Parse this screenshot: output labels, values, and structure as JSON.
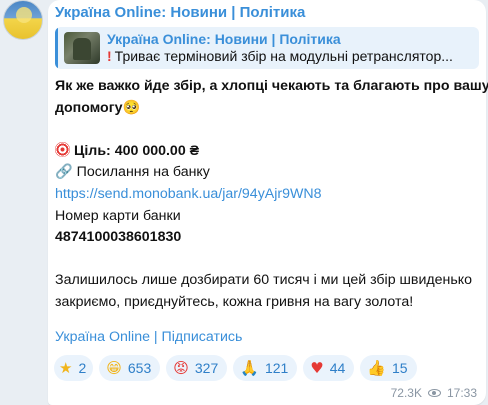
{
  "channel": {
    "title": "Україна Online: Новини | Політика"
  },
  "reply": {
    "title": "Україна Online: Новини | Політика",
    "icon": "exclamation-icon",
    "snippet": "Триває терміновий збір на модульні ретранслятор..."
  },
  "message": {
    "line1": "Як же важко йде збір, а хлопці чекають та благають про вашу",
    "line2": "допомогу",
    "goal_label": "Ціль: 400 000.00 ₴",
    "bank_link_label": "Посилання на банку",
    "bank_url": "https://send.monobank.ua/jar/94yAjr9WN8",
    "card_label": "Номер карти банки",
    "card_number": "4874100038601830",
    "remaining_line1": "Залишилось лише дозбирати 60 тисяч і ми цей збір швиденько",
    "remaining_line2": "закриємо, приєднуйтесь, кожна гривня на вагу золота!"
  },
  "footer": {
    "subscribe_link": "Україна Online | Підписатись"
  },
  "reactions": [
    {
      "icon": "star-icon",
      "count": "2"
    },
    {
      "icon": "grin-icon",
      "count": "653"
    },
    {
      "icon": "angry-icon",
      "count": "327"
    },
    {
      "icon": "pray-icon",
      "count": "121"
    },
    {
      "icon": "heart-icon",
      "count": "44"
    },
    {
      "icon": "thumbs-up-icon",
      "count": "15"
    }
  ],
  "meta": {
    "views": "72.3K",
    "time": "17:33"
  },
  "colors": {
    "accent": "#3a8fd9",
    "background": "#e9eef3",
    "reaction_bg": "#eaf3fc"
  }
}
